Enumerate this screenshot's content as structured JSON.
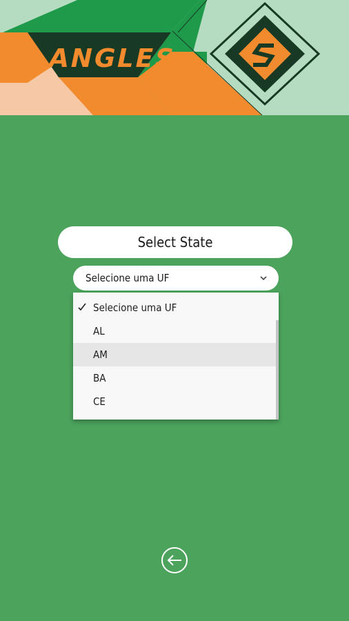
{
  "header": {
    "logo_text": "ANGLES",
    "badge_icon": "s-badge-icon"
  },
  "main": {
    "title": "Select State",
    "select": {
      "value": "Selecione uma UF",
      "icon": "chevron-down-icon",
      "options": [
        {
          "label": "Selecione uma UF",
          "selected": true
        },
        {
          "label": "AL",
          "selected": false
        },
        {
          "label": "AM",
          "selected": false,
          "highlighted": true
        },
        {
          "label": "BA",
          "selected": false
        },
        {
          "label": "CE",
          "selected": false
        }
      ]
    }
  },
  "footer": {
    "back_icon": "arrow-left-circle-icon"
  },
  "colors": {
    "background": "#4ba35c",
    "orange": "#f28a2e",
    "dark_green": "#183a25",
    "bright_green": "#1f9a4a",
    "pale_green": "#b5dcc0",
    "peach": "#f7c8a6"
  }
}
